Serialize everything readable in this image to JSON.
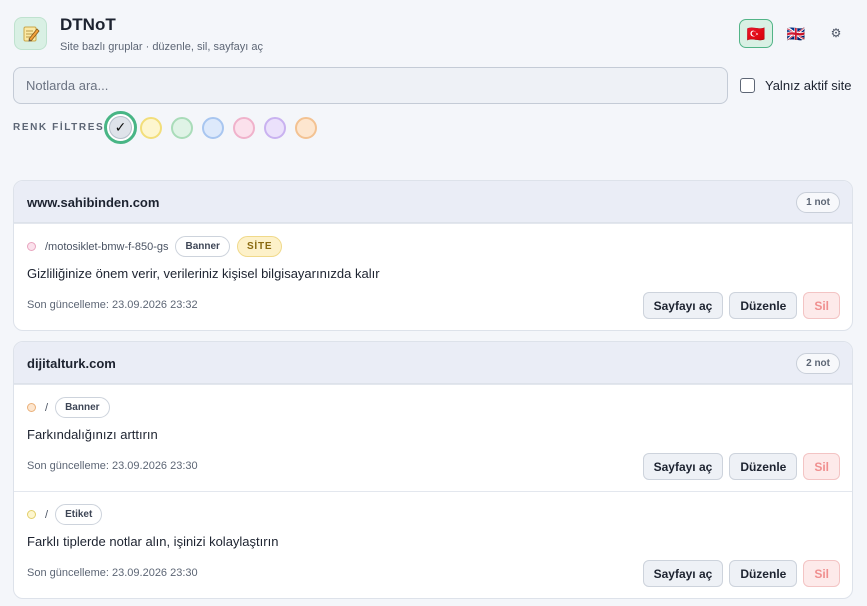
{
  "header": {
    "title": "DTNoT",
    "subtitle": "Site bazlı gruplar · düzenle, sil, sayfayı aç",
    "app_icon": "notepad-icon",
    "languages": [
      {
        "flag": "🇹🇷",
        "active": true
      },
      {
        "flag": "🇬🇧",
        "active": false
      }
    ],
    "settings_icon": "gear-icon"
  },
  "search": {
    "placeholder": "Notlarda ara...",
    "value": ""
  },
  "active_only": {
    "label": "Yalnız aktif site",
    "checked": false
  },
  "color_filter": {
    "label": "RENK FİLTRESİ",
    "selected": "all",
    "swatches": [
      {
        "name": "all",
        "fill": "#dfe3ea",
        "border": "#48b585"
      },
      {
        "name": "yellow",
        "fill": "#fdf6cf",
        "border": "#f2de7a"
      },
      {
        "name": "green",
        "fill": "#dff3e6",
        "border": "#a9dcb9"
      },
      {
        "name": "blue",
        "fill": "#dde9fb",
        "border": "#a8c6f0"
      },
      {
        "name": "pink",
        "fill": "#fbe1ec",
        "border": "#f0b2cb"
      },
      {
        "name": "purple",
        "fill": "#ebe1fb",
        "border": "#c9b2f0"
      },
      {
        "name": "orange",
        "fill": "#fde6cf",
        "border": "#f3c292"
      }
    ]
  },
  "groups": [
    {
      "domain": "www.sahibinden.com",
      "count": "1 not",
      "notes": [
        {
          "dot_fill": "#fbe1ec",
          "dot_border": "#e8a5bf",
          "path": "/motosiklet-bmw-f-850-gs",
          "type": "Banner",
          "scope": "SİTE",
          "text": "Gizliliğinize önem verir, verileriniz kişisel bilgisayarınızda kalır",
          "updated": "Son güncelleme: 23.09.2026 23:32"
        }
      ]
    },
    {
      "domain": "dijitalturk.com",
      "count": "2 not",
      "notes": [
        {
          "dot_fill": "#fde6cf",
          "dot_border": "#eab07a",
          "path": "/",
          "type": "Banner",
          "text": "Farkındalığınızı arttırın",
          "updated": "Son güncelleme: 23.09.2026 23:30"
        },
        {
          "dot_fill": "#fdf6cf",
          "dot_border": "#e2cf6b",
          "path": "/",
          "type": "Etiket",
          "text": "Farklı tiplerde notlar alın, işinizi kolaylaştırın",
          "updated": "Son güncelleme: 23.09.2026 23:30"
        }
      ]
    }
  ],
  "actions": {
    "open": "Sayfayı aç",
    "edit": "Düzenle",
    "delete": "Sil"
  }
}
